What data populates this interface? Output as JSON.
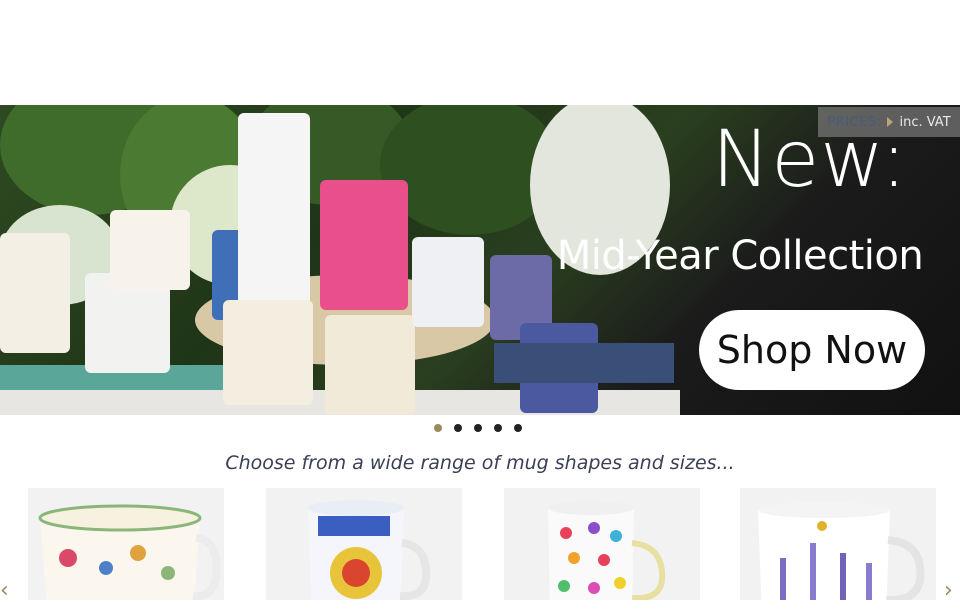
{
  "header": {
    "prices_label": "PRICES:",
    "prices_value": "inc. VAT"
  },
  "hero": {
    "title": "New:",
    "subtitle": "Mid-Year Collection",
    "cta_label": "Shop Now"
  },
  "slider": {
    "slide_count": 5,
    "active_index": 0,
    "colors": {
      "active": "#9b8a5a",
      "inactive": "#222222"
    }
  },
  "section": {
    "tagline": "Choose from a wide range of mug shapes and sizes..."
  },
  "carousel": {
    "prev_arrow": "‹",
    "next_arrow": "›",
    "items": [
      {
        "icon": "floral-mug-icon"
      },
      {
        "icon": "physics-mug-icon"
      },
      {
        "icon": "hearts-mug-icon"
      },
      {
        "icon": "lavender-mug-icon"
      }
    ]
  }
}
